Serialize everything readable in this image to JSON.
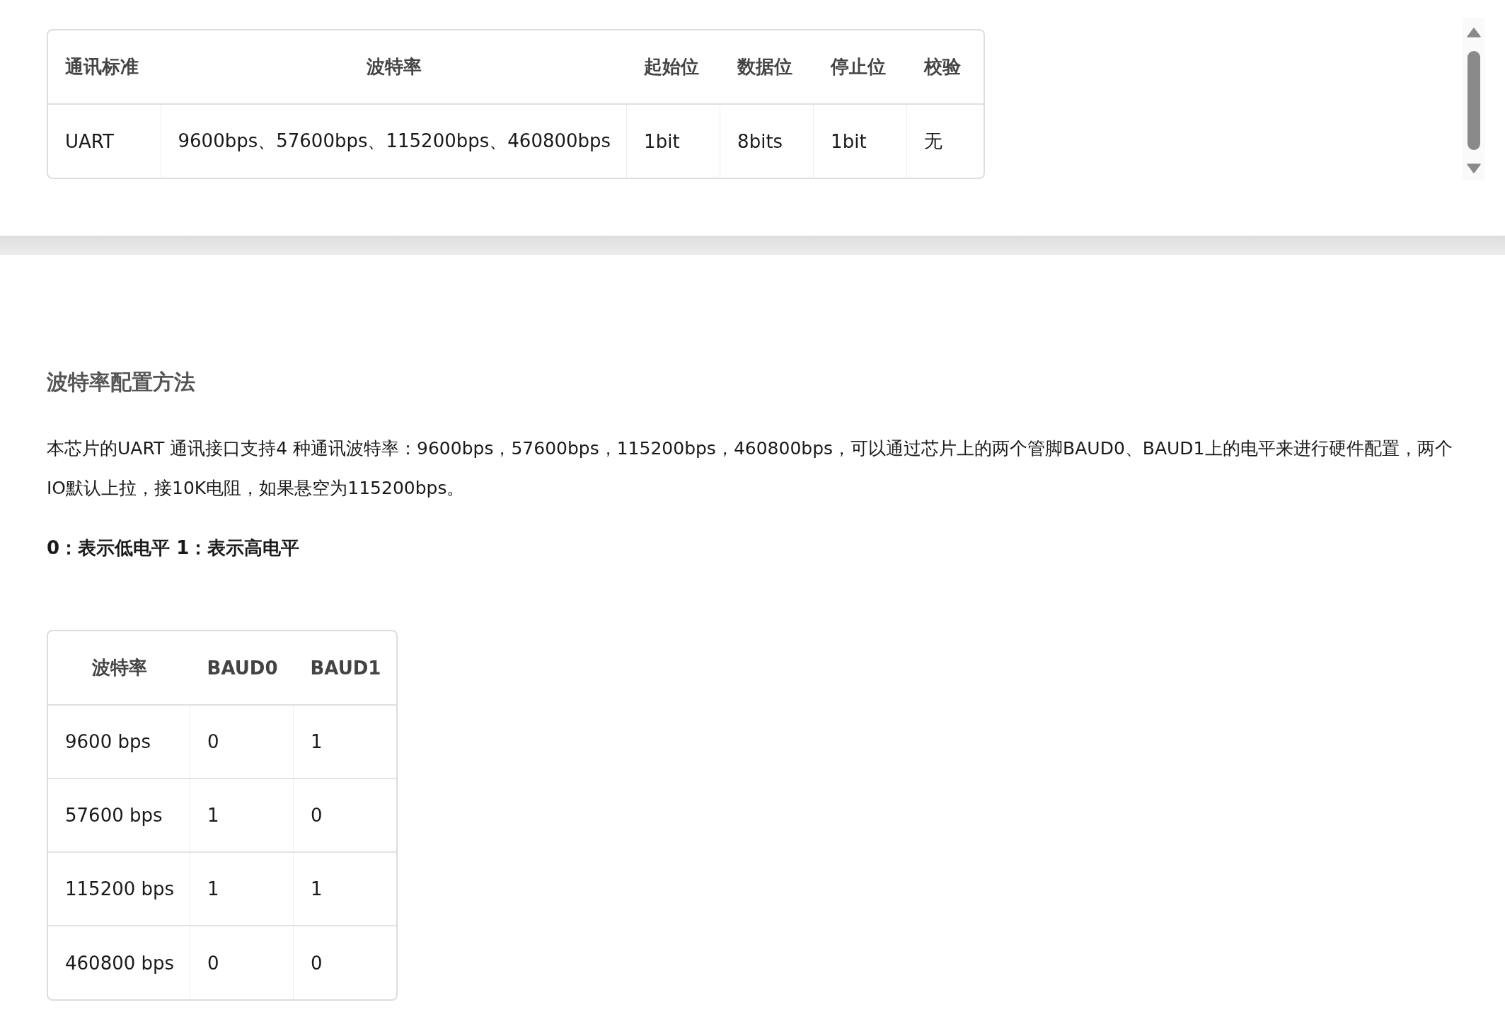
{
  "spec_table": {
    "columns": [
      "通讯标准",
      "波特率",
      "起始位",
      "数据位",
      "停止位",
      "校验"
    ],
    "rows": [
      [
        "UART",
        "9600bps、57600bps、115200bps、460800bps",
        "1bit",
        "8bits",
        "1bit",
        "无"
      ]
    ]
  },
  "section": {
    "heading": "波特率配置方法",
    "paragraph": "本芯片的UART 通讯接口支持4 种通讯波特率：9600bps，57600bps，115200bps，460800bps，可以通过芯片上的两个管脚BAUD0、BAUD1上的电平来进行硬件配置，两个IO默认上拉，接10K电阻，如果悬空为115200bps。",
    "note": "0：表示低电平 1：表示高电平"
  },
  "baud_table": {
    "columns": [
      "波特率",
      "BAUD0",
      "BAUD1"
    ],
    "rows": [
      [
        "9600 bps",
        "0",
        "1"
      ],
      [
        "57600 bps",
        "1",
        "0"
      ],
      [
        "115200 bps",
        "1",
        "1"
      ],
      [
        "460800 bps",
        "0",
        "0"
      ]
    ]
  }
}
